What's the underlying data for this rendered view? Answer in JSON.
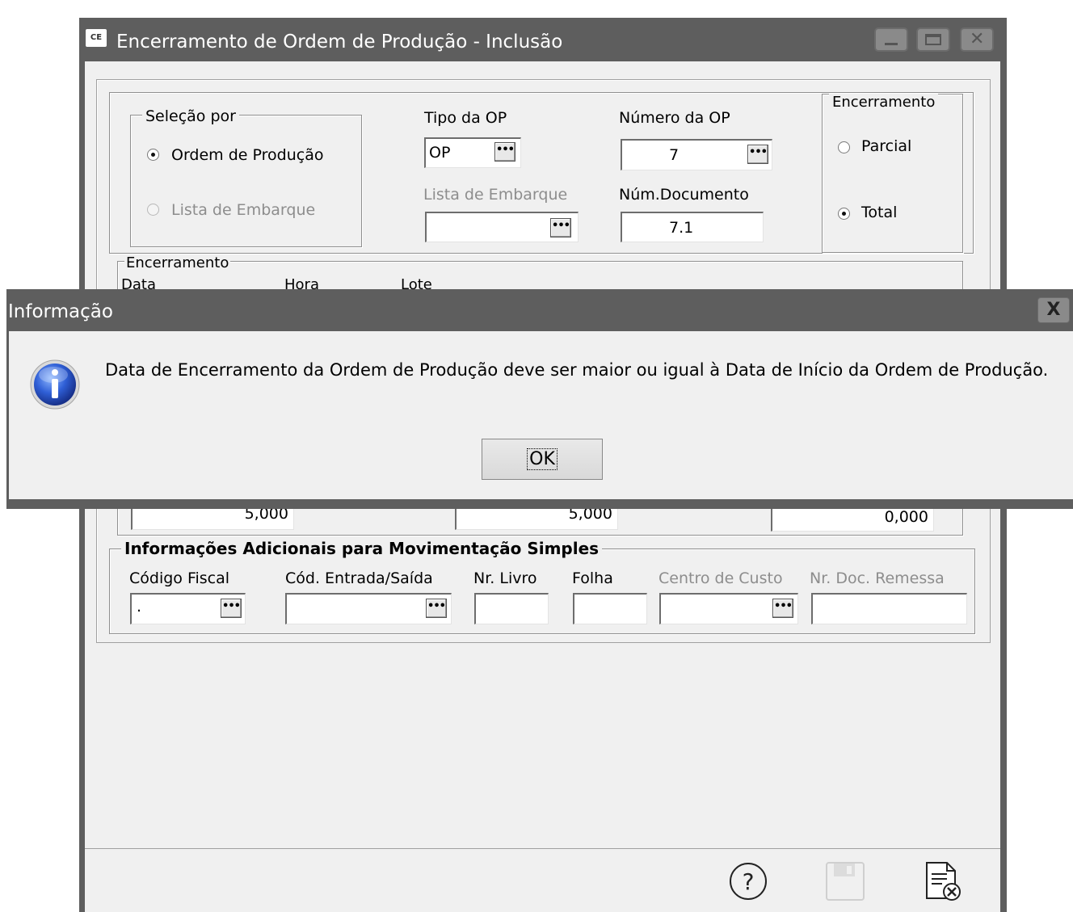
{
  "main_window": {
    "app_icon_text": "CE",
    "title": "Encerramento de Ordem de Produção - Inclusão",
    "selecao": {
      "legend": "Seleção por",
      "options": [
        "Ordem de Produção",
        "Lista de Embarque"
      ],
      "selected": "Ordem de Produção"
    },
    "tipo_op": {
      "label": "Tipo da OP",
      "value": "OP"
    },
    "numero_op": {
      "label": "Número da OP",
      "value": "7"
    },
    "lista_embarque": {
      "label": "Lista de Embarque",
      "value": ""
    },
    "num_documento": {
      "label": "Núm.Documento",
      "value": "7.1"
    },
    "encerramento_tipo": {
      "legend": "Encerramento",
      "options": [
        "Parcial",
        "Total"
      ],
      "selected": "Total"
    },
    "encerramento_group": {
      "legend": "Encerramento",
      "data_label": "Data",
      "hora_label": "Hora",
      "lote_label": "Lote",
      "qty_values": [
        "5,000",
        "5,000",
        "0,000"
      ]
    },
    "info_adicionais": {
      "legend": "Informações Adicionais para Movimentação Simples",
      "codigo_fiscal": {
        "label": "Código Fiscal",
        "value": "."
      },
      "cod_entrada_saida": {
        "label": "Cód. Entrada/Saída",
        "value": ""
      },
      "nr_livro": {
        "label": "Nr. Livro",
        "value": ""
      },
      "folha": {
        "label": "Folha",
        "value": ""
      },
      "centro_custo": {
        "label": "Centro de Custo",
        "value": ""
      },
      "nr_doc_remessa": {
        "label": "Nr. Doc. Remessa",
        "value": ""
      }
    },
    "dots_label": "•••",
    "toolbar": {
      "help_icon": "help-icon",
      "save_icon": "save-icon",
      "cancel_icon": "cancel-document-icon"
    }
  },
  "dialog": {
    "title": "Informação",
    "close_label": "X",
    "message": "Data de Encerramento da Ordem de Produção deve ser maior ou igual à Data de Início da Ordem de Produção.",
    "ok_label": "OK",
    "icon": "info-icon"
  }
}
